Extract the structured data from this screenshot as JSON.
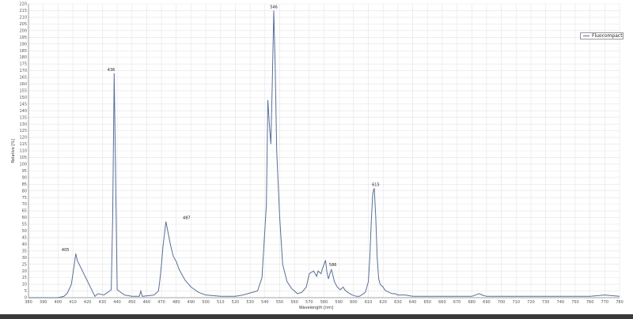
{
  "chart_data": {
    "type": "line",
    "xlabel": "Wavelength [nm]",
    "ylabel": "Relative [%]",
    "xlim": [
      380,
      780
    ],
    "ylim": [
      0,
      220
    ],
    "x_ticks": [
      380,
      390,
      400,
      410,
      420,
      430,
      440,
      450,
      460,
      470,
      480,
      490,
      500,
      510,
      520,
      530,
      540,
      550,
      560,
      570,
      580,
      590,
      600,
      610,
      620,
      630,
      640,
      650,
      660,
      670,
      680,
      690,
      700,
      710,
      720,
      730,
      740,
      750,
      760,
      770,
      780
    ],
    "y_ticks": [
      0,
      5,
      10,
      15,
      20,
      25,
      30,
      35,
      40,
      45,
      50,
      55,
      60,
      65,
      70,
      75,
      80,
      85,
      90,
      95,
      100,
      105,
      110,
      115,
      120,
      125,
      130,
      135,
      140,
      145,
      150,
      155,
      160,
      165,
      170,
      175,
      180,
      185,
      190,
      195,
      200,
      205,
      210,
      215,
      220
    ],
    "grid": true,
    "legend_position": "top-right",
    "series": [
      {
        "name": "Fluocompact",
        "color": "#5a6f96",
        "x": [
          380,
          400,
          404,
          406,
          407,
          409,
          411,
          412,
          413,
          425,
          427,
          431,
          435,
          436,
          437,
          438,
          440,
          445,
          450,
          455,
          456,
          457,
          465,
          468,
          469,
          470,
          471,
          473,
          476,
          478,
          480,
          482,
          486,
          490,
          495,
          500,
          510,
          520,
          525,
          535,
          538,
          541,
          542,
          543,
          544,
          545,
          546,
          547,
          548,
          550,
          552,
          555,
          558,
          562,
          565,
          568,
          570,
          573,
          575,
          576,
          578,
          579,
          581,
          582,
          583,
          584,
          585,
          586,
          587,
          588,
          589,
          590,
          591,
          592,
          593,
          594,
          596,
          599,
          602,
          604,
          608,
          610,
          611,
          612,
          613,
          614,
          615,
          616,
          617,
          618,
          619,
          620,
          621,
          622,
          624,
          626,
          628,
          630,
          632,
          635,
          640,
          650,
          660,
          680,
          685,
          687,
          690,
          700,
          720,
          730,
          740,
          760,
          770,
          780
        ],
        "y": [
          0,
          0,
          1,
          3,
          5,
          10,
          25,
          33,
          28,
          1,
          3,
          2,
          5,
          6,
          60,
          168,
          6,
          2,
          1,
          1,
          5,
          1,
          2,
          5,
          14,
          25,
          38,
          57,
          40,
          31,
          27,
          21,
          13,
          8,
          4,
          2,
          1,
          1,
          2,
          5,
          15,
          70,
          148,
          130,
          115,
          160,
          215,
          170,
          110,
          60,
          25,
          12,
          7,
          3,
          4,
          8,
          18,
          20,
          16,
          20,
          18,
          22,
          28,
          19,
          14,
          18,
          21,
          17,
          12,
          10,
          8,
          7,
          6,
          7,
          8,
          6,
          4,
          2,
          1,
          1,
          4,
          12,
          30,
          58,
          78,
          82,
          60,
          30,
          14,
          10,
          9,
          8,
          6,
          5,
          4,
          3,
          3,
          2,
          2,
          2,
          1,
          1,
          1,
          1,
          3,
          2,
          1,
          1,
          1,
          1,
          1,
          1,
          2,
          1
        ]
      }
    ],
    "annotations": [
      {
        "x": 405,
        "y": 33,
        "label": "405"
      },
      {
        "x": 436,
        "y": 168,
        "label": "436"
      },
      {
        "x": 487,
        "y": 57,
        "label": "487"
      },
      {
        "x": 546,
        "y": 215,
        "label": "546"
      },
      {
        "x": 586,
        "y": 22,
        "label": "586"
      },
      {
        "x": 615,
        "y": 82,
        "label": "615"
      }
    ]
  }
}
